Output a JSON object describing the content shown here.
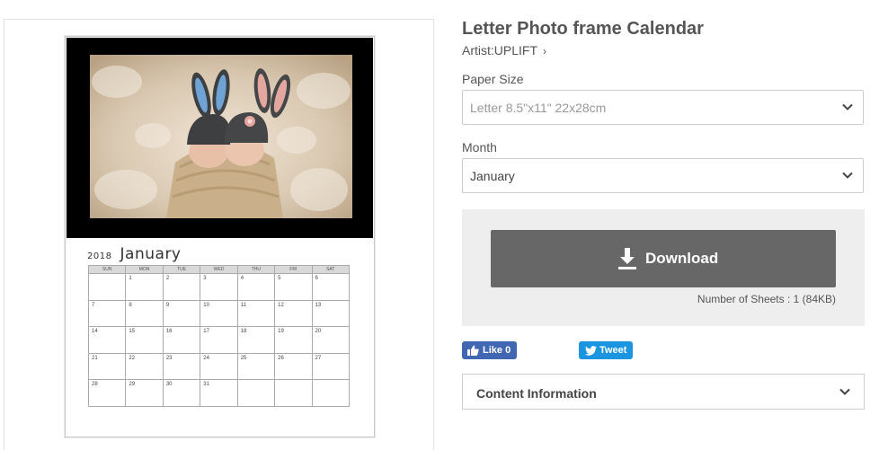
{
  "product": {
    "title": "Letter Photo frame Calendar",
    "artist_label": "Artist:UPLIFT",
    "artist_chevron": "›"
  },
  "preview": {
    "year": "2018",
    "month": "January",
    "weekdays": [
      "SUN",
      "MON",
      "TUE",
      "WED",
      "THU",
      "FRI",
      "SAT"
    ],
    "weeks": [
      [
        "",
        "1",
        "2",
        "3",
        "4",
        "5",
        "6"
      ],
      [
        "7",
        "8",
        "9",
        "10",
        "11",
        "12",
        "13"
      ],
      [
        "14",
        "15",
        "16",
        "17",
        "18",
        "19",
        "20"
      ],
      [
        "21",
        "22",
        "23",
        "24",
        "25",
        "26",
        "27"
      ],
      [
        "28",
        "29",
        "30",
        "31",
        "",
        "",
        ""
      ]
    ]
  },
  "options": {
    "paper_size_label": "Paper Size",
    "paper_size_value": "Letter 8.5\"x11\" 22x28cm",
    "month_label": "Month",
    "month_value": "January"
  },
  "download": {
    "button_label": "Download",
    "sheets_info": "Number of Sheets : 1 (84KB)"
  },
  "social": {
    "like_label": "Like 0",
    "tweet_label": "Tweet"
  },
  "content_info": {
    "label": "Content Information"
  },
  "colors": {
    "download_button": "#676767",
    "facebook": "#4267b2",
    "twitter": "#1b95e0"
  }
}
